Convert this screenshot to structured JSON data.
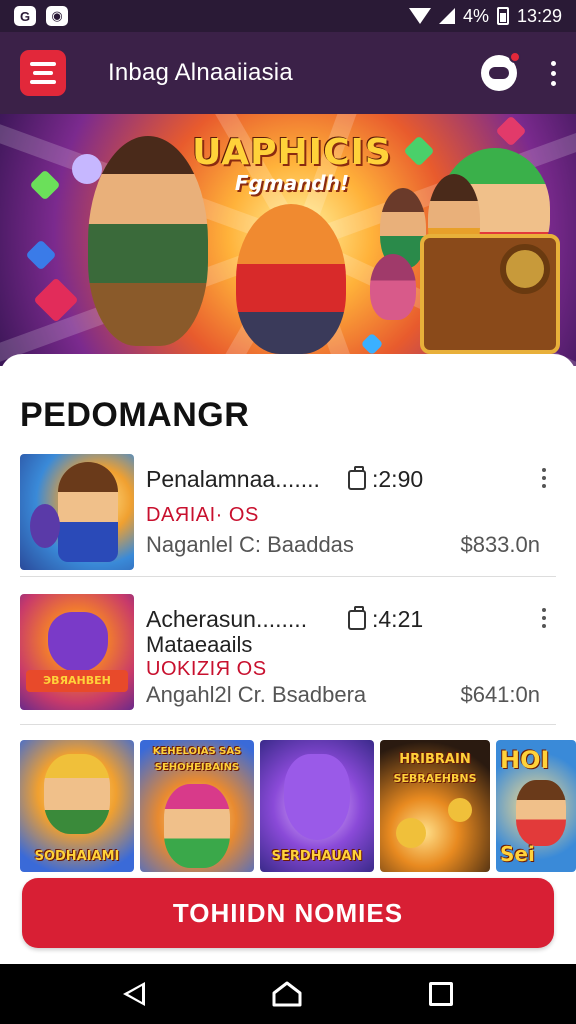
{
  "status_bar": {
    "battery": "4%",
    "time": "13:29"
  },
  "app_bar": {
    "title": "Inbag Alnaaiiasia"
  },
  "banner": {
    "title_line1": "UAPHICIS",
    "title_line2": "Fgmandh!"
  },
  "section": {
    "title": "PEDOMANGR"
  },
  "items": [
    {
      "title": "Penalamnaa.......",
      "time": ":2:90",
      "tag": "DAЯIAI· OS",
      "meta": "Naganlel C: Baaddas",
      "price": "$833.0n"
    },
    {
      "title": "Acherasun........",
      "subtitle": "Mataeaails",
      "time": ":4:21",
      "tag": "UOKIZIЯ OS",
      "meta": "Angahl2l Cr. Bsadbera",
      "price": "$641:0n"
    }
  ],
  "thumb_labels": {
    "item2": "ЭВЯАНВЕН"
  },
  "carousel": [
    {
      "top_label": "",
      "bottom_label": "SODHAIAMI"
    },
    {
      "top_label": "KEHELOIAS SAS",
      "sub_label": "SEHOHEIBAINS",
      "bottom_label": ""
    },
    {
      "top_label": "",
      "bottom_label": "SERDHAUAN"
    },
    {
      "top_label": "HRIBRAIN",
      "sub_label": "SEBRAEHBNS",
      "bottom_label": ""
    },
    {
      "top_label": "HOI",
      "bottom_label": "Sei"
    }
  ],
  "cta": {
    "label": "TOHIIDN NOMIES"
  },
  "colors": {
    "accent": "#d81f34",
    "app_bar": "#3b2148",
    "status_bar": "#2a1a36"
  },
  "icons": [
    "app-logo-icon",
    "gamepad-icon",
    "more-vert-icon",
    "timer-icon",
    "back-icon",
    "home-icon",
    "recents-icon"
  ]
}
